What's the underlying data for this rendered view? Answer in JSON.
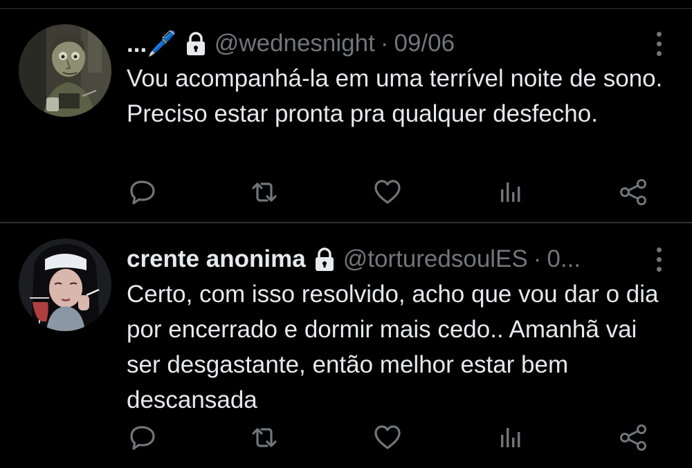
{
  "tweets": [
    {
      "display_name": "...🖊️",
      "locked_icon": "lock-icon",
      "handle": "@wednesnight",
      "separator": "·",
      "date": "09/06",
      "text": "Vou acompanhá-la em uma terrível noite de sono. Preciso estar pronta pra qualquer desfecho.",
      "actions": [
        "reply-icon",
        "retweet-icon",
        "like-icon",
        "views-icon",
        "share-icon"
      ]
    },
    {
      "display_name": "crente anonima",
      "locked_icon": "lock-icon",
      "handle": "@torturedsoulES",
      "separator": "·",
      "date": "0...",
      "text": "Certo, com isso resolvido, acho que vou dar o dia por encerrado e dormir mais cedo.. Amanhã vai ser desgastante, então melhor estar bem descansada",
      "actions": [
        "reply-icon",
        "retweet-icon",
        "like-icon",
        "views-icon",
        "share-icon"
      ]
    }
  ],
  "colors": {
    "background": "#000000",
    "text": "#e7e9ea",
    "muted": "#71767b",
    "divider": "#2f3336"
  }
}
